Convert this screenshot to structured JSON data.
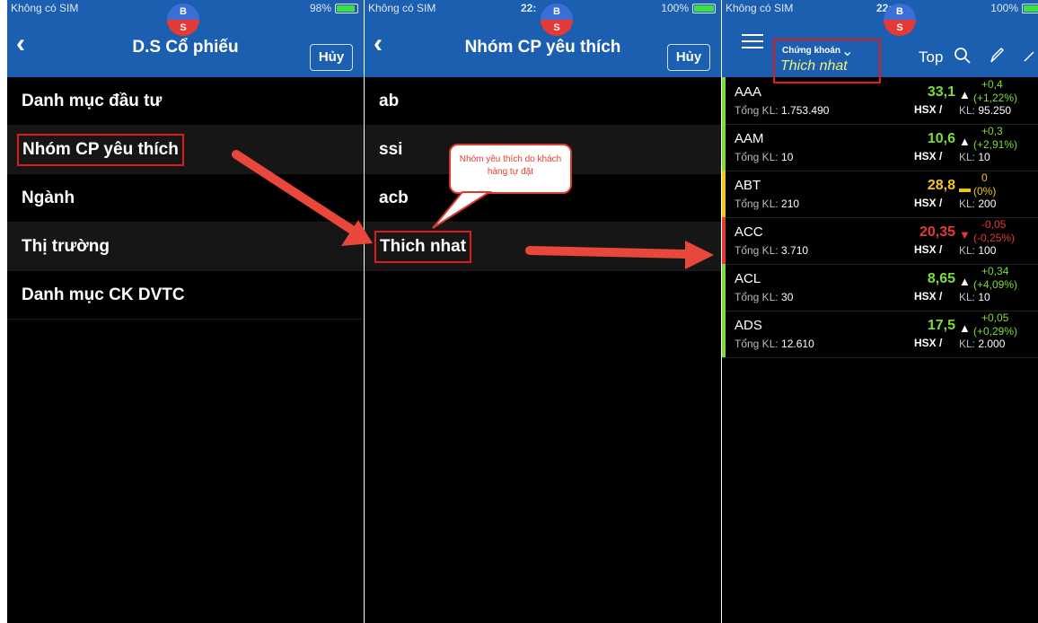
{
  "status": {
    "carrier": "Không có SIM",
    "p1_battery": "98%",
    "p1_time": "B",
    "p2_time": "22:",
    "p2_battery": "100%",
    "p3_time": "22:",
    "p3_battery": "100%"
  },
  "bs_badge": {
    "top": "B",
    "bottom": "S"
  },
  "panel1": {
    "title": "D.S Cổ phiếu",
    "cancel": "Hủy",
    "items": [
      "Danh mục đầu tư",
      "Nhóm CP yêu thích",
      "Ngành",
      "Thị trường",
      "Danh mục CK DVTC"
    ]
  },
  "panel2": {
    "title": "Nhóm CP yêu thích",
    "cancel": "Hủy",
    "items": [
      "ab",
      "ssi",
      "acb",
      "Thich nhat"
    ],
    "annotation": "Nhóm yêu thích do khách hàng tự đặt"
  },
  "panel3": {
    "selector_label": "Chứng khoán",
    "selector_value": "Thich nhat",
    "top_label": "Top",
    "vol_label": "Tổng KL:",
    "kl_label": "KL:",
    "stocks": [
      {
        "symbol": "AAA",
        "total_vol": "1.753.490",
        "price": "33,1",
        "exchange": "HSX /",
        "chg": "+0,4",
        "pct": "(+1,22%)",
        "kl": "95.250",
        "color": "#7ddc3a",
        "dir": "up"
      },
      {
        "symbol": "AAM",
        "total_vol": "10",
        "price": "10,6",
        "exchange": "HSX /",
        "chg": "+0,3",
        "pct": "(+2,91%)",
        "kl": "10",
        "color": "#7ddc3a",
        "dir": "up"
      },
      {
        "symbol": "ABT",
        "total_vol": "210",
        "price": "28,8",
        "exchange": "HSX /",
        "chg": "0",
        "pct": "(0%)",
        "kl": "200",
        "color": "#f5c518",
        "dir": "flat"
      },
      {
        "symbol": "ACC",
        "total_vol": "3.710",
        "price": "20,35",
        "exchange": "HSX /",
        "chg": "-0,05",
        "pct": "(-0,25%)",
        "kl": "100",
        "color": "#e53935",
        "dir": "down"
      },
      {
        "symbol": "ACL",
        "total_vol": "30",
        "price": "8,65",
        "exchange": "HSX /",
        "chg": "+0,34",
        "pct": "(+4,09%)",
        "kl": "10",
        "color": "#7ddc3a",
        "dir": "up"
      },
      {
        "symbol": "ADS",
        "total_vol": "12.610",
        "price": "17,5",
        "exchange": "HSX /",
        "chg": "+0,05",
        "pct": "(+0,29%)",
        "kl": "2.000",
        "color": "#7ddc3a",
        "dir": "up"
      }
    ]
  },
  "colors": {
    "navbar": "#1c5fb0",
    "highlight": "#e11b1b",
    "arrow": "#e8473c"
  }
}
